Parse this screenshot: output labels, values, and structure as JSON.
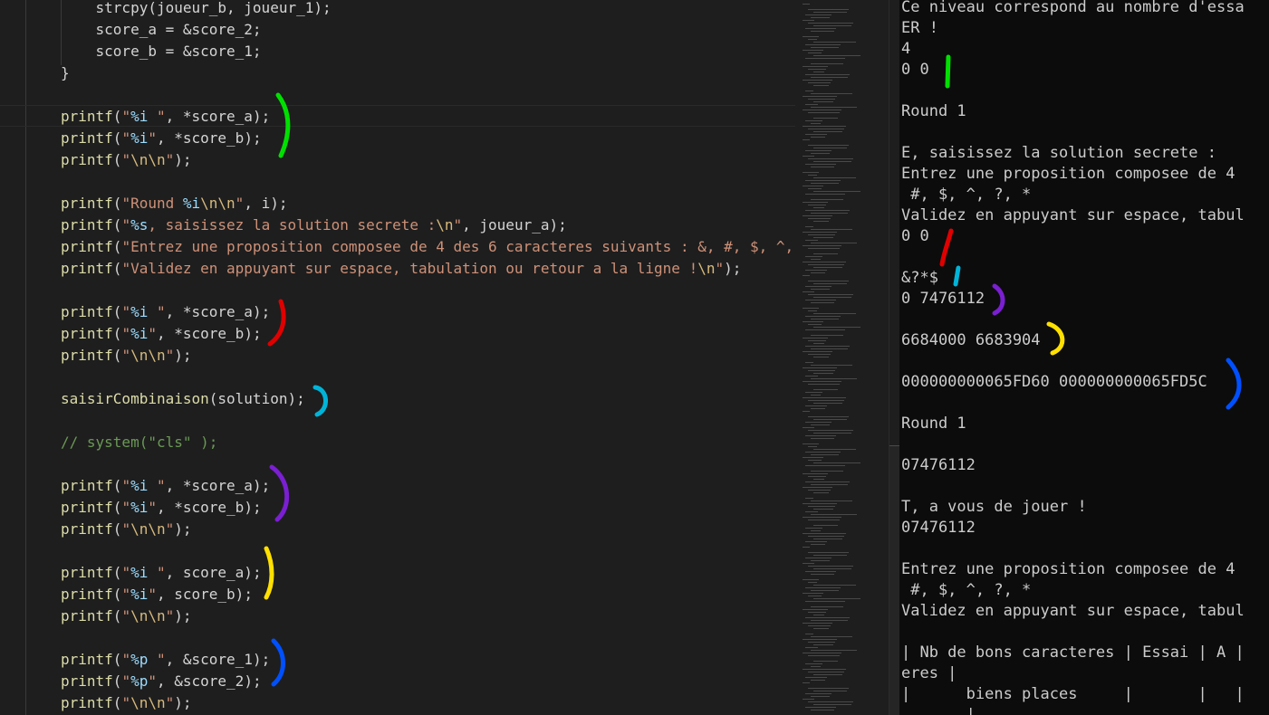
{
  "editor": {
    "lines": [
      [
        "    ",
        [
          "",
          "strcpy(joueur_b, joueur_1);"
        ]
      ],
      [
        "    ",
        [
          "",
          "score_a = &score_2;"
        ]
      ],
      [
        "    ",
        [
          "",
          "score_b = &score_1;"
        ]
      ],
      [
        "",
        [
          "",
          "}"
        ]
      ],
      [],
      [
        "",
        [
          "fn",
          "printf"
        ],
        [
          "",
          "("
        ],
        [
          "str",
          "\""
        ],
        [
          "fmt",
          "%i"
        ],
        [
          "str",
          " \""
        ],
        [
          "",
          ", *score_a);"
        ]
      ],
      [
        "",
        [
          "fn",
          "printf"
        ],
        [
          "",
          "("
        ],
        [
          "str",
          "\""
        ],
        [
          "fmt",
          "%i"
        ],
        [
          "str",
          "\""
        ],
        [
          "",
          ", *score_b);"
        ]
      ],
      [
        "",
        [
          "fn",
          "printf"
        ],
        [
          "",
          "("
        ],
        [
          "str",
          "\""
        ],
        [
          "esc",
          "\\n\\n"
        ],
        [
          "str",
          "\""
        ],
        [
          "",
          ");"
        ]
      ],
      [],
      [
        "",
        [
          "fn",
          "printf"
        ],
        [
          "",
          "("
        ],
        [
          "str",
          "\"Round "
        ],
        [
          "fmt",
          "%i"
        ],
        [
          "esc",
          "\\n\\n"
        ],
        [
          "str",
          "\""
        ],
        [
          "",
          ", i);"
        ]
      ],
      [
        "",
        [
          "fn",
          "printf"
        ],
        [
          "",
          "("
        ],
        [
          "str",
          "\""
        ],
        [
          "fmt",
          "%s"
        ],
        [
          "str",
          ", saisissez la solution secrete :"
        ],
        [
          "esc",
          "\\n"
        ],
        [
          "str",
          "\""
        ],
        [
          "",
          ", joueur_a);"
        ]
      ],
      [
        "",
        [
          "fn",
          "printf"
        ],
        [
          "",
          "("
        ],
        [
          "str",
          "\"Entrez une proposition composee de 4 des 6 caracteres suivants : &, #, $, ^,"
        ]
      ],
      [
        "",
        [
          "fn",
          "printf"
        ],
        [
          "",
          "("
        ],
        [
          "str",
          "\"Validez en appuyant sur espace, tabulation ou retour a la ligne !"
        ],
        [
          "esc",
          "\\n"
        ],
        [
          "str",
          "\""
        ],
        [
          "",
          ");"
        ]
      ],
      [],
      [
        "",
        [
          "fn",
          "printf"
        ],
        [
          "",
          "("
        ],
        [
          "str",
          "\""
        ],
        [
          "fmt",
          "%i"
        ],
        [
          "str",
          " \""
        ],
        [
          "",
          ", *score_a);"
        ]
      ],
      [
        "",
        [
          "fn",
          "printf"
        ],
        [
          "",
          "("
        ],
        [
          "str",
          "\""
        ],
        [
          "fmt",
          "%i"
        ],
        [
          "str",
          "\""
        ],
        [
          "",
          ", *score_b);"
        ]
      ],
      [
        "",
        [
          "fn",
          "printf"
        ],
        [
          "",
          "("
        ],
        [
          "str",
          "\""
        ],
        [
          "esc",
          "\\n\\n"
        ],
        [
          "str",
          "\""
        ],
        [
          "",
          ");"
        ]
      ],
      [],
      [
        "",
        [
          "fn",
          "saisirCombinaison"
        ],
        [
          "",
          "(solution);"
        ]
      ],
      [],
      [
        "",
        [
          "cmt",
          "// system(\"cls\" );"
        ]
      ],
      [],
      [
        "",
        [
          "fn",
          "printf"
        ],
        [
          "",
          "("
        ],
        [
          "str",
          "\""
        ],
        [
          "fmt",
          "%i"
        ],
        [
          "str",
          " \""
        ],
        [
          "",
          ", *score_a);"
        ]
      ],
      [
        "",
        [
          "fn",
          "printf"
        ],
        [
          "",
          "("
        ],
        [
          "str",
          "\""
        ],
        [
          "fmt",
          "%i"
        ],
        [
          "str",
          "\""
        ],
        [
          "",
          ", *score_b);"
        ]
      ],
      [
        "",
        [
          "fn",
          "printf"
        ],
        [
          "",
          "("
        ],
        [
          "str",
          "\""
        ],
        [
          "esc",
          "\\n\\n"
        ],
        [
          "str",
          "\""
        ],
        [
          "",
          ");"
        ]
      ],
      [],
      [
        "",
        [
          "fn",
          "printf"
        ],
        [
          "",
          "("
        ],
        [
          "str",
          "\""
        ],
        [
          "fmt",
          "%i"
        ],
        [
          "str",
          " \""
        ],
        [
          "",
          ", score_a);"
        ]
      ],
      [
        "",
        [
          "fn",
          "printf"
        ],
        [
          "",
          "("
        ],
        [
          "str",
          "\""
        ],
        [
          "fmt",
          "%i"
        ],
        [
          "str",
          "\""
        ],
        [
          "",
          ", score_b);"
        ]
      ],
      [
        "",
        [
          "fn",
          "printf"
        ],
        [
          "",
          "("
        ],
        [
          "str",
          "\""
        ],
        [
          "esc",
          "\\n\\n"
        ],
        [
          "str",
          "\""
        ],
        [
          "",
          ");"
        ]
      ],
      [],
      [
        "",
        [
          "fn",
          "printf"
        ],
        [
          "",
          "("
        ],
        [
          "str",
          "\""
        ],
        [
          "fmt",
          "%p"
        ],
        [
          "str",
          " \""
        ],
        [
          "",
          ", &score_1);"
        ]
      ],
      [
        "",
        [
          "fn",
          "printf"
        ],
        [
          "",
          "("
        ],
        [
          "str",
          "\""
        ],
        [
          "fmt",
          "%p"
        ],
        [
          "str",
          "\""
        ],
        [
          "",
          ", &score_2);"
        ]
      ],
      [
        "",
        [
          "fn",
          "printf"
        ],
        [
          "",
          "("
        ],
        [
          "str",
          "\""
        ],
        [
          "esc",
          "\\n\\n"
        ],
        [
          "str",
          "\""
        ],
        [
          "",
          ");"
        ]
      ]
    ]
  },
  "terminal": {
    "lines": [
      "Ce niveau correspond au nombre d'essa",
      "ER !",
      "4",
      "0 0",
      "",
      "Round 1",
      "",
      "E, saisissez la solution secrete :",
      "Entrez une proposition composee de 4",
      " #, $, ^, ?, *",
      "Validez en appuyant sur espace, tabul",
      "0 0",
      "",
      "&?*$",
      "0 7476112",
      "",
      "6684000 6683904",
      "",
      "000000000065FD60 000000000065FD5C",
      "",
      "Round 1",
      "",
      "07476112",
      "",
      "T, a vous de jouer !",
      "07476112",
      "",
      "Entrez une proposition composee de 4",
      " #, $, ^, ?, *",
      "Validez en appuyant sur espace, tabul",
      "",
      "| Nb de bons caracteres | Essai | A |",
      "eres |",
      "|      biens places     |       |   |",
      "       |"
    ]
  },
  "annotations": [
    {
      "color": "#00e000"
    },
    {
      "color": "#e00000"
    },
    {
      "color": "#00b4d8"
    },
    {
      "color": "#7a1fd1"
    },
    {
      "color": "#ffe000"
    },
    {
      "color": "#0050ff"
    }
  ],
  "colors": {
    "editor_bg": "#1e1e1e",
    "terminal_bg": "#0c0c0c",
    "string": "#ce9178",
    "function": "#dcdcaa",
    "format": "#9cdcfe",
    "comment": "#6a9955"
  }
}
